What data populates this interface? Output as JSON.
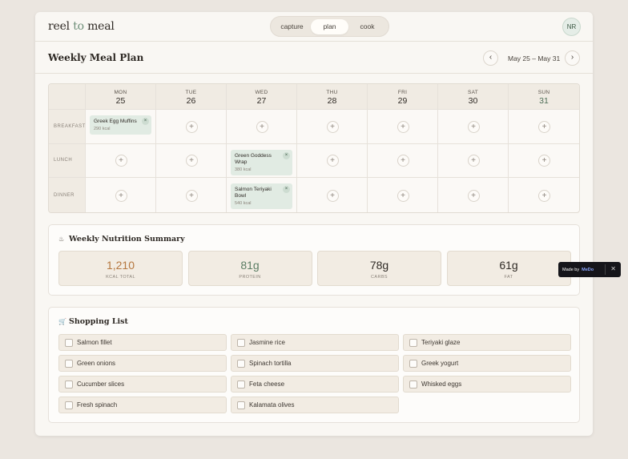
{
  "app": {
    "logo_pre": "reel",
    "logo_mid": " to ",
    "logo_post": "meal"
  },
  "nav": {
    "tabs": [
      "capture",
      "plan",
      "cook"
    ],
    "active": "plan"
  },
  "user": {
    "initials": "NR"
  },
  "planner": {
    "title": "Weekly Meal Plan",
    "range": "May 25 – May 31",
    "days": [
      {
        "name": "MON",
        "num": "25"
      },
      {
        "name": "TUE",
        "num": "26"
      },
      {
        "name": "WED",
        "num": "27"
      },
      {
        "name": "THU",
        "num": "28"
      },
      {
        "name": "FRI",
        "num": "29"
      },
      {
        "name": "SAT",
        "num": "30"
      },
      {
        "name": "SUN",
        "num": "31"
      }
    ],
    "meals": [
      "BREAKFAST",
      "LUNCH",
      "DINNER"
    ],
    "entries": {
      "mon_breakfast": {
        "name": "Greek Egg Muffins",
        "kcal": "290 kcal"
      },
      "wed_lunch": {
        "name": "Green Goddess Wrap",
        "kcal": "380 kcal"
      },
      "wed_dinner": {
        "name": "Salmon Teriyaki Bowl",
        "kcal": "540 kcal"
      }
    }
  },
  "nutrition": {
    "title": "Weekly Nutrition Summary",
    "stats": [
      {
        "value": "1,210",
        "label": "KCAL TOTAL",
        "color": "#b5773f"
      },
      {
        "value": "81g",
        "label": "PROTEIN",
        "color": "#5b7d64"
      },
      {
        "value": "78g",
        "label": "CARBS",
        "color": "#2f2a25"
      },
      {
        "value": "61g",
        "label": "FAT",
        "color": "#2f2a25"
      }
    ]
  },
  "shopping": {
    "title": "Shopping List",
    "items": [
      "Salmon fillet",
      "Jasmine rice",
      "Teriyaki glaze",
      "Green onions",
      "Spinach tortilla",
      "Greek yogurt",
      "Cucumber slices",
      "Feta cheese",
      "Whisked eggs",
      "Fresh spinach",
      "Kalamata olives"
    ]
  },
  "badge": {
    "pre": "Made by",
    "brand": "MeDo"
  }
}
